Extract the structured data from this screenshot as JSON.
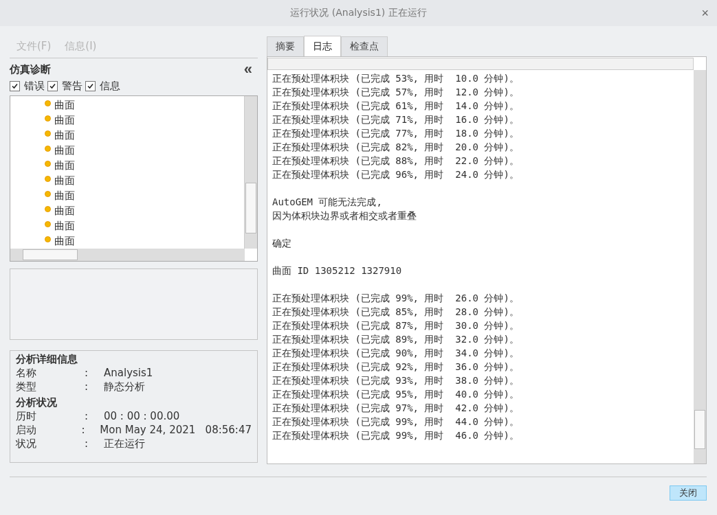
{
  "window": {
    "title": "运行状况 (Analysis1) 正在运行",
    "close": "×"
  },
  "menu": [
    {
      "label": "文件(F)",
      "disabled": true
    },
    {
      "label": "信息(I)",
      "disabled": true
    }
  ],
  "diagnostics": {
    "title": "仿真诊断",
    "collapse": "«",
    "filters": [
      {
        "label": "错误",
        "checked": true
      },
      {
        "label": "警告",
        "checked": true
      },
      {
        "label": "信息",
        "checked": true
      }
    ],
    "items": [
      {
        "label": "曲面",
        "color": "#f5b800"
      },
      {
        "label": "曲面",
        "color": "#f5b800"
      },
      {
        "label": "曲面",
        "color": "#f5b800"
      },
      {
        "label": "曲面",
        "color": "#f5b800"
      },
      {
        "label": "曲面",
        "color": "#f5b800"
      },
      {
        "label": "曲面",
        "color": "#f5b800"
      },
      {
        "label": "曲面",
        "color": "#f5b800"
      },
      {
        "label": "曲面",
        "color": "#f5b800"
      },
      {
        "label": "曲面",
        "color": "#f5b800"
      },
      {
        "label": "曲面",
        "color": "#f5b800"
      }
    ]
  },
  "details": {
    "title": "分析详细信息",
    "rows": [
      {
        "label": "名称",
        "sep": ":",
        "value": "Analysis1"
      },
      {
        "label": "类型",
        "sep": ":",
        "value": "静态分析"
      }
    ]
  },
  "status": {
    "title": "分析状况",
    "rows": [
      {
        "label": "历时",
        "sep": ":",
        "value": "00 : 00 : 00.00"
      },
      {
        "label": "启动",
        "sep": ":",
        "value": "Mon May 24, 2021   08:56:47"
      },
      {
        "label": "状况",
        "sep": ":",
        "value": "正在运行"
      }
    ]
  },
  "tabs": [
    {
      "label": "摘要",
      "selected": false
    },
    {
      "label": "日志",
      "selected": true
    },
    {
      "label": "检查点",
      "selected": false
    }
  ],
  "log": [
    {
      "lines": [
        "正在预处理体积块 (已完成 53%, 用时  10.0 分钟)。",
        "正在预处理体积块 (已完成 57%, 用时  12.0 分钟)。",
        "正在预处理体积块 (已完成 61%, 用时  14.0 分钟)。",
        "正在预处理体积块 (已完成 71%, 用时  16.0 分钟)。",
        "正在预处理体积块 (已完成 77%, 用时  18.0 分钟)。",
        "正在预处理体积块 (已完成 82%, 用时  20.0 分钟)。",
        "正在预处理体积块 (已完成 88%, 用时  22.0 分钟)。",
        "正在预处理体积块 (已完成 96%, 用时  24.0 分钟)。"
      ]
    },
    {
      "lines": [
        "AutoGEM 可能无法完成,",
        "因为体积块边界或者相交或者重叠"
      ]
    },
    {
      "lines": [
        "确定"
      ]
    },
    {
      "lines": [
        "曲面 ID 1305212 1327910"
      ]
    },
    {
      "lines": [
        "正在预处理体积块 (已完成 99%, 用时  26.0 分钟)。",
        "正在预处理体积块 (已完成 85%, 用时  28.0 分钟)。",
        "正在预处理体积块 (已完成 87%, 用时  30.0 分钟)。",
        "正在预处理体积块 (已完成 89%, 用时  32.0 分钟)。",
        "正在预处理体积块 (已完成 90%, 用时  34.0 分钟)。",
        "正在预处理体积块 (已完成 92%, 用时  36.0 分钟)。",
        "正在预处理体积块 (已完成 93%, 用时  38.0 分钟)。",
        "正在预处理体积块 (已完成 95%, 用时  40.0 分钟)。",
        "正在预处理体积块 (已完成 97%, 用时  42.0 分钟)。",
        "正在预处理体积块 (已完成 99%, 用时  44.0 分钟)。",
        "正在预处理体积块 (已完成 99%, 用时  46.0 分钟)。"
      ]
    }
  ],
  "buttons": [
    {
      "label": "关闭"
    }
  ]
}
